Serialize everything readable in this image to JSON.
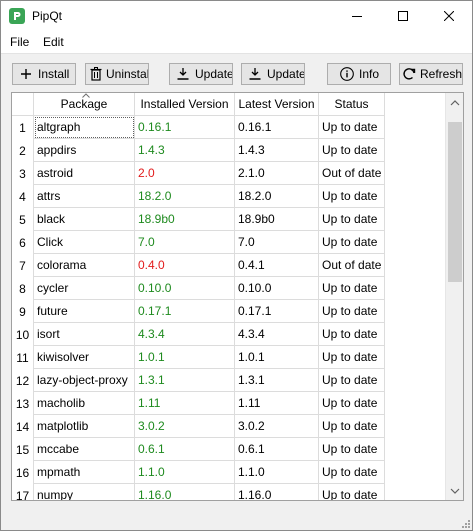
{
  "window": {
    "title": "PipQt",
    "controls": [
      "minimize-icon",
      "maximize-icon",
      "close-icon"
    ]
  },
  "menu": {
    "file": "File",
    "edit": "Edit"
  },
  "toolbar": {
    "install": "Install",
    "uninstall": "Uninstall",
    "update": "Update",
    "update_all": "Update A",
    "info": "Info",
    "refresh": "Refresh"
  },
  "table": {
    "columns": [
      "Package",
      "Installed Version",
      "Latest Version",
      "Status"
    ],
    "sorted_column": "Package",
    "rows": [
      {
        "num": "1",
        "package": "altgraph",
        "installed": "0.16.1",
        "latest": "0.16.1",
        "status": "Up to date",
        "state": "ok"
      },
      {
        "num": "2",
        "package": "appdirs",
        "installed": "1.4.3",
        "latest": "1.4.3",
        "status": "Up to date",
        "state": "ok"
      },
      {
        "num": "3",
        "package": "astroid",
        "installed": "2.0",
        "latest": "2.1.0",
        "status": "Out of date",
        "state": "old"
      },
      {
        "num": "4",
        "package": "attrs",
        "installed": "18.2.0",
        "latest": "18.2.0",
        "status": "Up to date",
        "state": "ok"
      },
      {
        "num": "5",
        "package": "black",
        "installed": "18.9b0",
        "latest": "18.9b0",
        "status": "Up to date",
        "state": "ok"
      },
      {
        "num": "6",
        "package": "Click",
        "installed": "7.0",
        "latest": "7.0",
        "status": "Up to date",
        "state": "ok"
      },
      {
        "num": "7",
        "package": "colorama",
        "installed": "0.4.0",
        "latest": "0.4.1",
        "status": "Out of date",
        "state": "old"
      },
      {
        "num": "8",
        "package": "cycler",
        "installed": "0.10.0",
        "latest": "0.10.0",
        "status": "Up to date",
        "state": "ok"
      },
      {
        "num": "9",
        "package": "future",
        "installed": "0.17.1",
        "latest": "0.17.1",
        "status": "Up to date",
        "state": "ok"
      },
      {
        "num": "10",
        "package": "isort",
        "installed": "4.3.4",
        "latest": "4.3.4",
        "status": "Up to date",
        "state": "ok"
      },
      {
        "num": "11",
        "package": "kiwisolver",
        "installed": "1.0.1",
        "latest": "1.0.1",
        "status": "Up to date",
        "state": "ok"
      },
      {
        "num": "12",
        "package": "lazy-object-proxy",
        "installed": "1.3.1",
        "latest": "1.3.1",
        "status": "Up to date",
        "state": "ok"
      },
      {
        "num": "13",
        "package": "macholib",
        "installed": "1.11",
        "latest": "1.11",
        "status": "Up to date",
        "state": "ok"
      },
      {
        "num": "14",
        "package": "matplotlib",
        "installed": "3.0.2",
        "latest": "3.0.2",
        "status": "Up to date",
        "state": "ok"
      },
      {
        "num": "15",
        "package": "mccabe",
        "installed": "0.6.1",
        "latest": "0.6.1",
        "status": "Up to date",
        "state": "ok"
      },
      {
        "num": "16",
        "package": "mpmath",
        "installed": "1.1.0",
        "latest": "1.1.0",
        "status": "Up to date",
        "state": "ok"
      },
      {
        "num": "17",
        "package": "numpy",
        "installed": "1.16.0",
        "latest": "1.16.0",
        "status": "Up to date",
        "state": "ok"
      }
    ]
  },
  "colors": {
    "up_to_date": "#1e8a1e",
    "out_of_date": "#e21b1b",
    "app_icon": "#3aa556"
  }
}
